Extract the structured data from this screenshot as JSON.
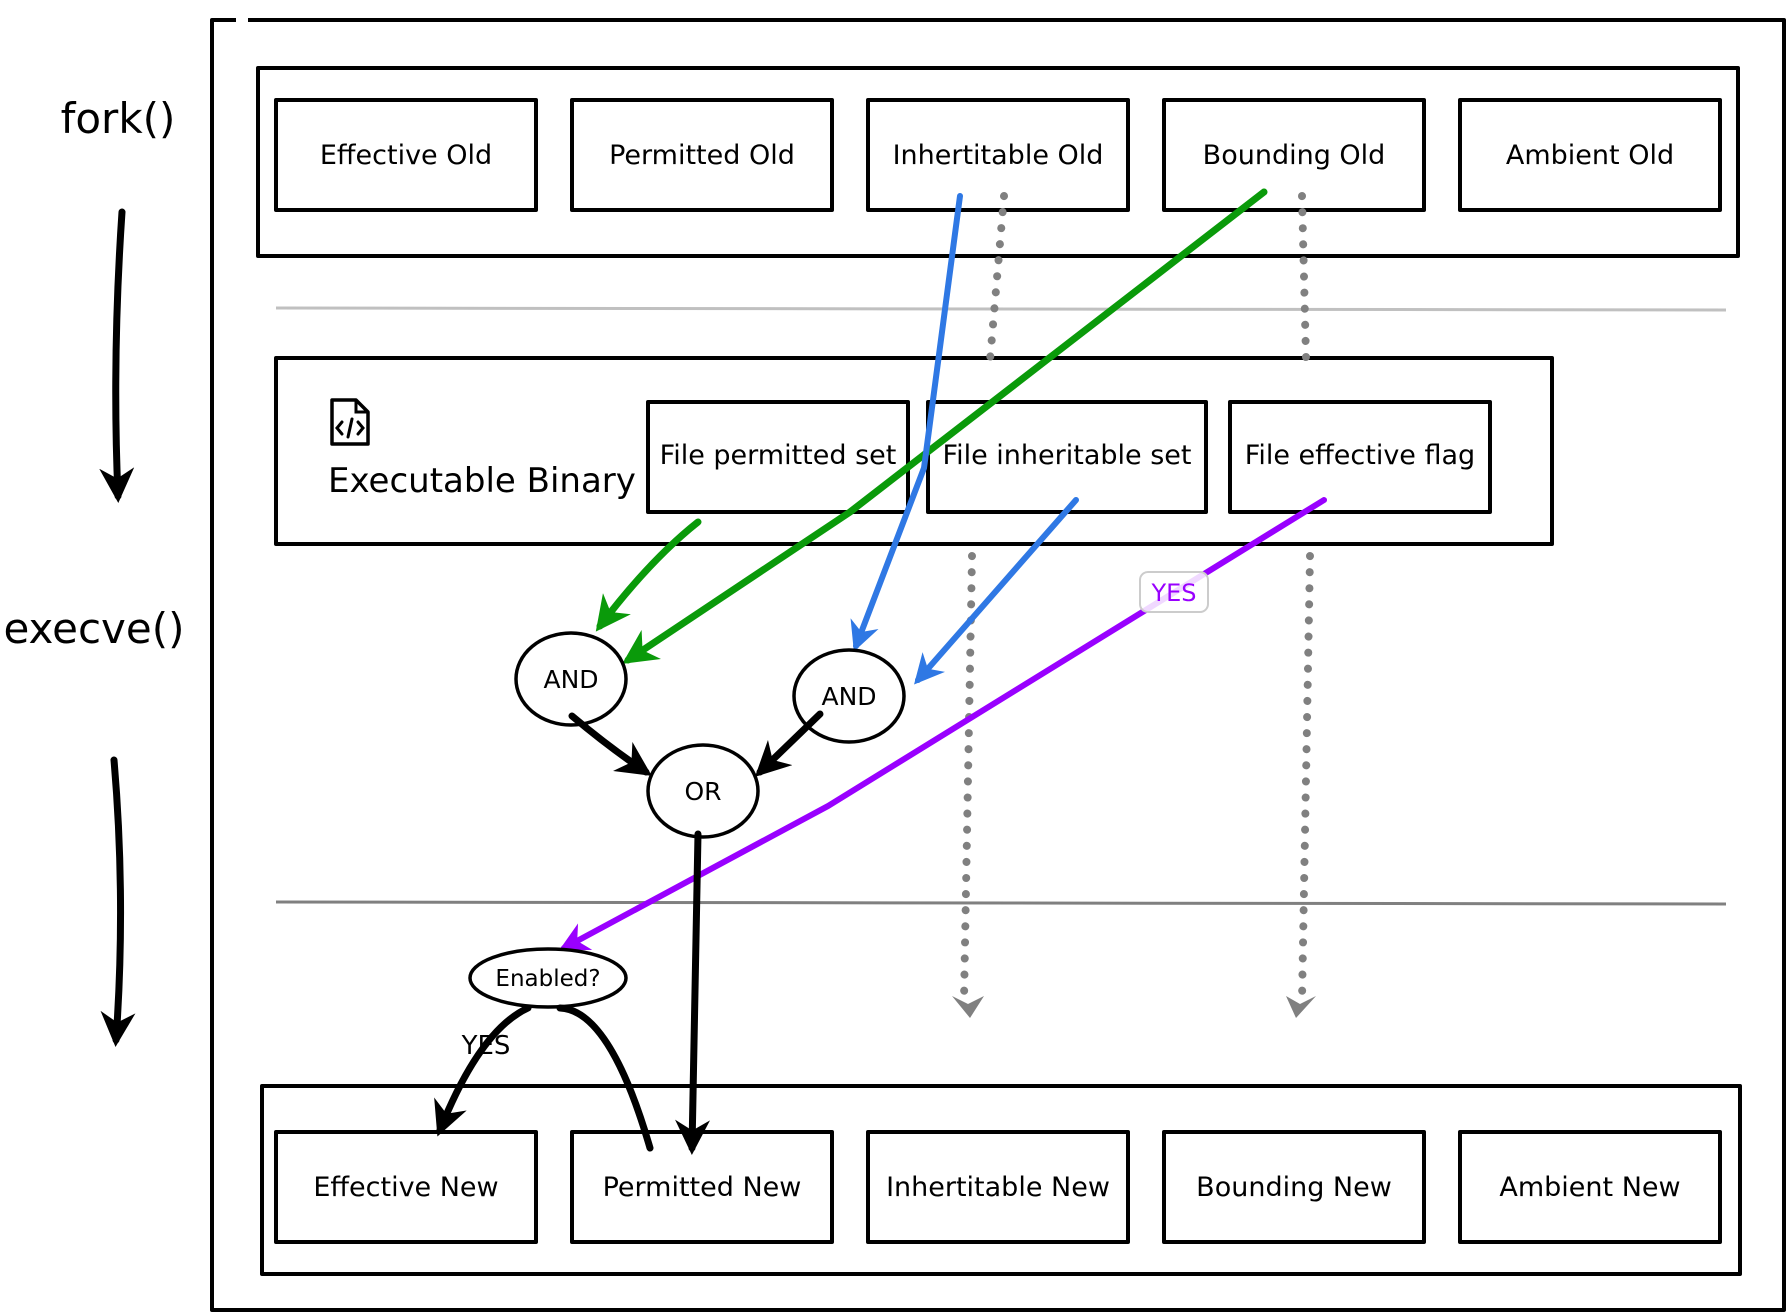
{
  "side_labels": {
    "fork": "fork()",
    "execve": "execve()"
  },
  "old_sets": [
    {
      "label": "Effective Old"
    },
    {
      "label": "Permitted Old"
    },
    {
      "label": "Inhertitable Old"
    },
    {
      "label": "Bounding Old"
    },
    {
      "label": "Ambient Old"
    }
  ],
  "binary": {
    "title": "Executable Binary",
    "icon": "file-code-icon",
    "sets": [
      {
        "label": "File permitted set"
      },
      {
        "label": "File inheritable set"
      },
      {
        "label": "File effective flag"
      }
    ]
  },
  "operators": {
    "and_left": "AND",
    "and_right": "AND",
    "or": "OR",
    "enabled": "Enabled?"
  },
  "edge_labels": {
    "yes_purple": "YES",
    "yes_black": "YES"
  },
  "new_sets": [
    {
      "label": "Effective New"
    },
    {
      "label": "Permitted New"
    },
    {
      "label": "Inhertitable New"
    },
    {
      "label": "Bounding New"
    },
    {
      "label": "Ambient New"
    }
  ],
  "colors": {
    "green": "#0a9a0a",
    "blue": "#2f78e4",
    "purple": "#9900ff",
    "dotted": "#808080",
    "separator_light": "#c0c0c0",
    "separator_dark": "#808080"
  }
}
